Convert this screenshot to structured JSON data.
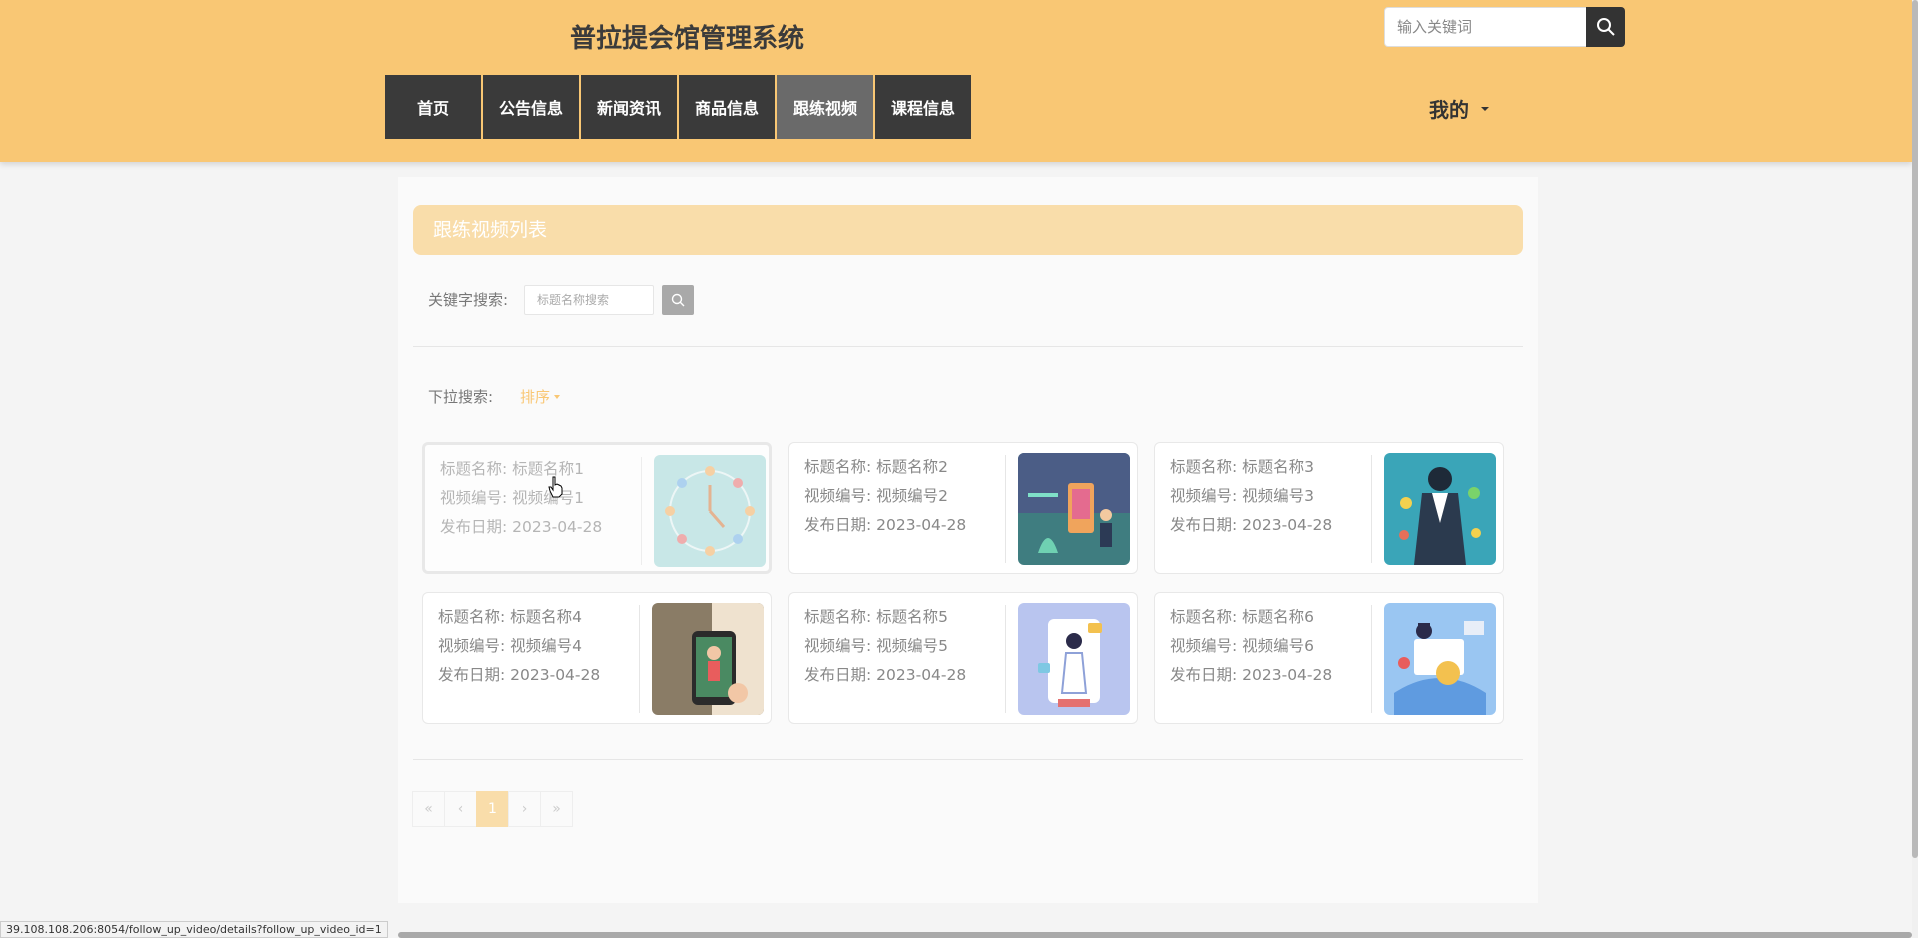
{
  "header": {
    "title": "普拉提会馆管理系统",
    "search_placeholder": "输入关键词",
    "nav": [
      {
        "label": "首页"
      },
      {
        "label": "公告信息"
      },
      {
        "label": "新闻资讯"
      },
      {
        "label": "商品信息"
      },
      {
        "label": "跟练视频",
        "active": true
      },
      {
        "label": "课程信息"
      }
    ],
    "mine_label": "我的"
  },
  "main": {
    "list_title": "跟练视频列表",
    "keyword_label": "关键字搜索:",
    "keyword_placeholder": "标题名称搜索",
    "dropdown_label": "下拉搜索:",
    "sort_label": "排序",
    "cards": [
      {
        "title_line": "标题名称: 标题名称1",
        "code_line": "视频编号: 视频编号1",
        "date_line": "发布日期: 2023-04-28"
      },
      {
        "title_line": "标题名称: 标题名称2",
        "code_line": "视频编号: 视频编号2",
        "date_line": "发布日期: 2023-04-28"
      },
      {
        "title_line": "标题名称: 标题名称3",
        "code_line": "视频编号: 视频编号3",
        "date_line": "发布日期: 2023-04-28"
      },
      {
        "title_line": "标题名称: 标题名称4",
        "code_line": "视频编号: 视频编号4",
        "date_line": "发布日期: 2023-04-28"
      },
      {
        "title_line": "标题名称: 标题名称5",
        "code_line": "视频编号: 视频编号5",
        "date_line": "发布日期: 2023-04-28"
      },
      {
        "title_line": "标题名称: 标题名称6",
        "code_line": "视频编号: 视频编号6",
        "date_line": "发布日期: 2023-04-28"
      }
    ],
    "pagination": {
      "first": "«",
      "prev": "‹",
      "current": "1",
      "next": "›",
      "last": "»"
    }
  },
  "status_url": "39.108.108.206:8054/follow_up_video/details?follow_up_video_id=1",
  "colors": {
    "header_bg": "#f9c774",
    "nav_bg": "#3a3a3a",
    "nav_active": "#6a6a6a",
    "title_bar": "#f9ddaa"
  }
}
